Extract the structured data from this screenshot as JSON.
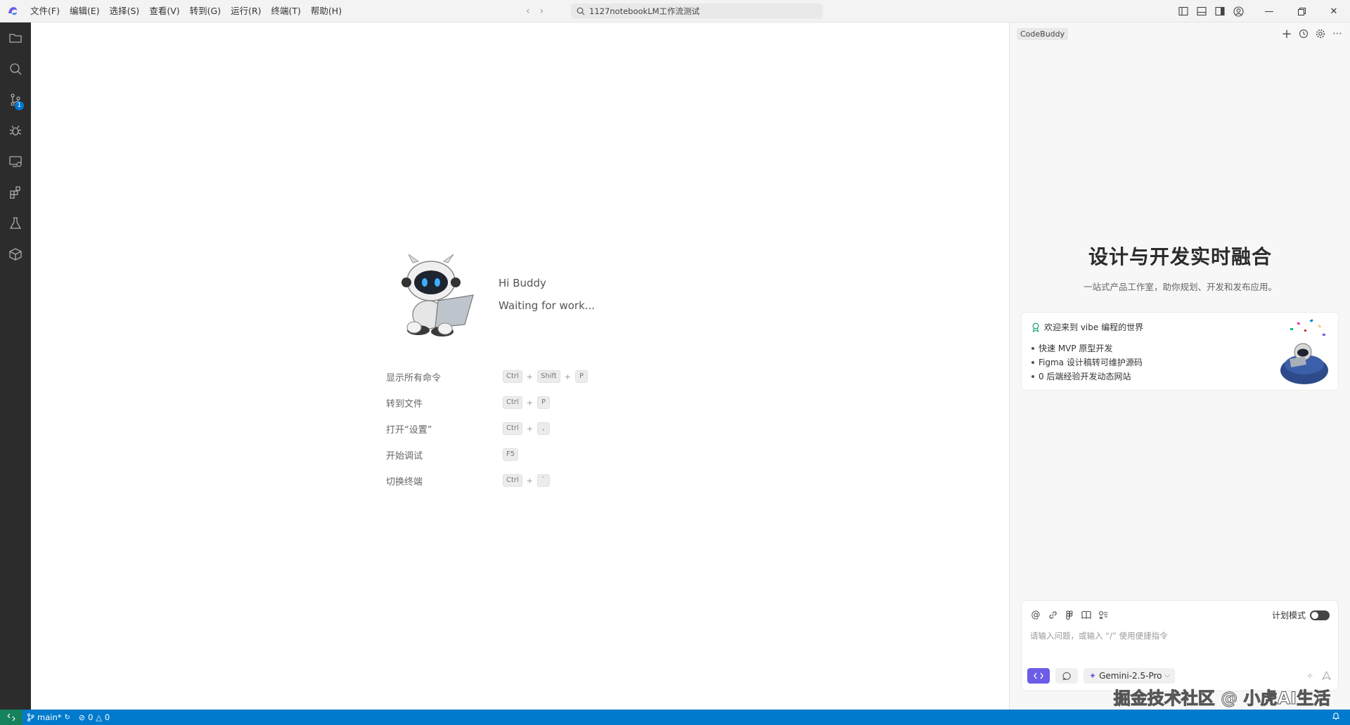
{
  "titlebar": {
    "menus": [
      "文件(F)",
      "编辑(E)",
      "选择(S)",
      "查看(V)",
      "转到(G)",
      "运行(R)",
      "终端(T)",
      "帮助(H)"
    ],
    "search_text": "1127notebookLM工作流测试"
  },
  "activitybar": {
    "items": [
      "explorer-icon",
      "search-icon",
      "source-control-icon",
      "debug-icon",
      "remote-explorer-icon",
      "extensions-icon",
      "testing-icon",
      "package-icon"
    ],
    "source_control_badge": "1"
  },
  "welcome": {
    "greeting": "Hi Buddy",
    "status": "Waiting for work...",
    "shortcuts": [
      {
        "label": "显示所有命令",
        "keys": [
          "Ctrl",
          "Shift",
          "P"
        ]
      },
      {
        "label": "转到文件",
        "keys": [
          "Ctrl",
          "P"
        ]
      },
      {
        "label": "打开“设置”",
        "keys": [
          "Ctrl",
          ","
        ]
      },
      {
        "label": "开始调试",
        "keys": [
          "F5"
        ]
      },
      {
        "label": "切换终端",
        "keys": [
          "Ctrl",
          "`"
        ]
      }
    ]
  },
  "panel": {
    "tag": "CodeBuddy",
    "hero_title": "设计与开发实时融合",
    "hero_subtitle": "一站式产品工作室，助你规划、开发和发布应用。",
    "card": {
      "title": "欢迎来到 vibe 编程的世界",
      "items": [
        "快速 MVP 原型开发",
        "Figma 设计稿转可维护源码",
        "0 后端经验开发动态网站"
      ]
    },
    "chat": {
      "plan_mode_label": "计划模式",
      "placeholder": "请输入问题，或输入 “/” 使用便捷指令",
      "model": "Gemini-2.5-Pro"
    }
  },
  "watermark": "掘金技术社区 @ 小虎AI生活",
  "statusbar": {
    "branch": "main*",
    "errors": "0",
    "warnings": "0"
  },
  "colors": {
    "statusbar": "#007acc",
    "activitybar": "#2c2c2c",
    "accent": "#6c5ce7",
    "badge": "#0078d4"
  }
}
